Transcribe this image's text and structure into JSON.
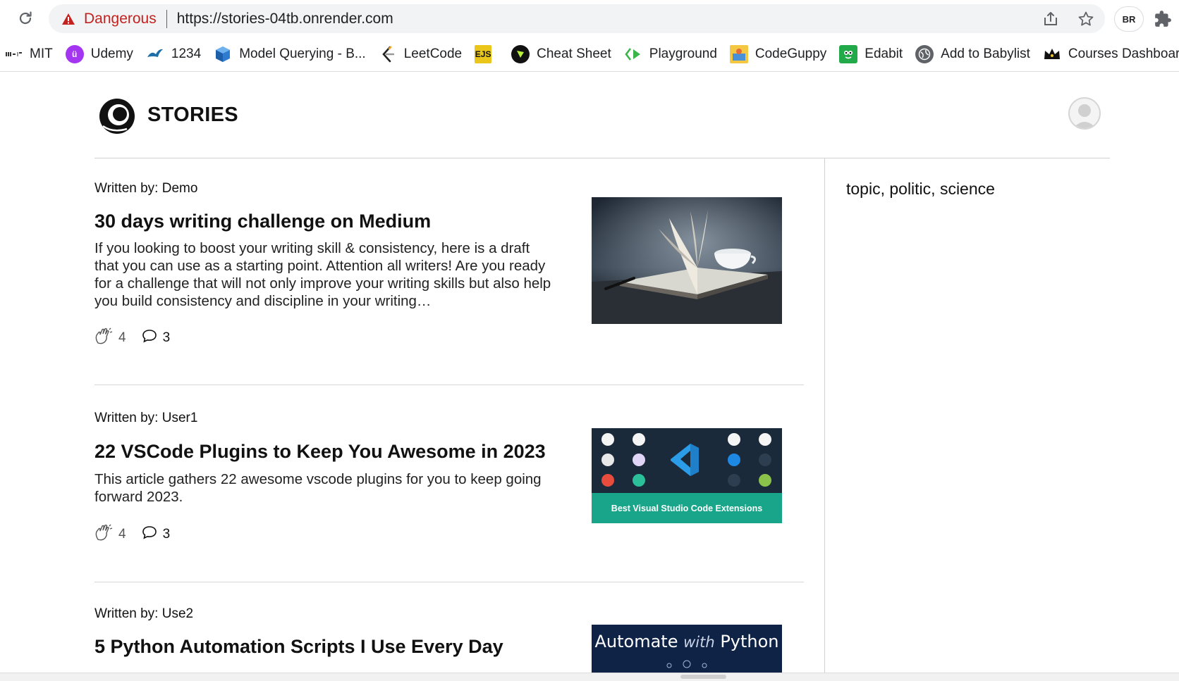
{
  "browser": {
    "security_label": "Dangerous",
    "url": "https://stories-04tb.onrender.com",
    "profile_initials": "BR",
    "bookmarks": [
      {
        "label": "MIT",
        "icon": "mit-logo-icon"
      },
      {
        "label": "Udemy",
        "icon": "udemy-icon"
      },
      {
        "label": "1234",
        "icon": "bird-icon"
      },
      {
        "label": "Model Querying - B...",
        "icon": "cube-icon"
      },
      {
        "label": "LeetCode",
        "icon": "leetcode-icon"
      },
      {
        "label": "",
        "icon": "ejs-icon",
        "badge": "EJS"
      },
      {
        "label": "Cheat Sheet",
        "icon": "cheat-sheet-icon"
      },
      {
        "label": "Playground",
        "icon": "playground-icon"
      },
      {
        "label": "CodeGuppy",
        "icon": "codeguppy-icon"
      },
      {
        "label": "Edabit",
        "icon": "edabit-icon"
      },
      {
        "label": "Add to Babylist",
        "icon": "globe-icon"
      },
      {
        "label": "Courses Dashboard",
        "icon": "crown-icon"
      }
    ]
  },
  "site": {
    "brand": "STORIES"
  },
  "articles": [
    {
      "author": "Written by: Demo",
      "title": "30 days writing challenge on Medium",
      "excerpt": "If you looking to boost your writing skill & consistency, here is a draft that you can use as a starting point. Attention all writers! Are you ready for a challenge that will not only improve your writing skills but also help you build consistency and discipline in your writing…",
      "claps": "4",
      "comments": "3"
    },
    {
      "author": "Written by: User1",
      "title": "22 VSCode Plugins to Keep You Awesome in 2023",
      "excerpt": "This article gathers 22 awesome vscode plugins for you to keep going forward 2023.",
      "claps": "4",
      "comments": "3",
      "image_caption": "Best Visual Studio Code Extensions"
    },
    {
      "author": "Written by: Use2",
      "title": "5 Python Automation Scripts I Use Every Day",
      "image_text_a": "Automate",
      "image_text_b": "with",
      "image_text_c": "Python"
    }
  ],
  "sidebar": {
    "topics": "topic, politic, science"
  },
  "colors": {
    "danger": "#c5221f",
    "omnibox_bg": "#f1f3f4",
    "teal_banner": "#19a589",
    "python_banner": "#0f2347",
    "vscode_bg": "#1b2a3a"
  }
}
